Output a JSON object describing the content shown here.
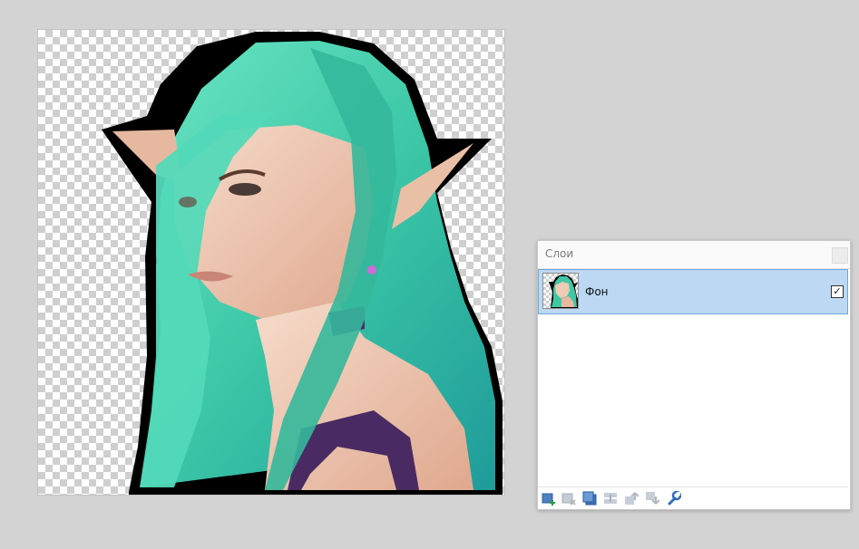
{
  "canvas": {
    "image_description_icon": "elf-portrait-image",
    "transparency_pattern": "checkerboard"
  },
  "layers_panel": {
    "title": "Слои",
    "layers": [
      {
        "name": "Фон",
        "visible": true,
        "selected": true,
        "visible_mark": "✓"
      }
    ],
    "toolbar": [
      {
        "icon": "add-layer-icon"
      },
      {
        "icon": "delete-layer-icon"
      },
      {
        "icon": "duplicate-layer-icon"
      },
      {
        "icon": "merge-layer-down-icon"
      },
      {
        "icon": "move-layer-up-icon"
      },
      {
        "icon": "move-layer-down-icon"
      },
      {
        "icon": "layer-properties-icon"
      }
    ]
  },
  "colors": {
    "background": "#d3d3d3",
    "selection": "#bcd8f2",
    "selection_border": "#6fa5d8",
    "hair": "#3fc9a6",
    "skin": "#f2cdb6",
    "outline": "#000000"
  }
}
